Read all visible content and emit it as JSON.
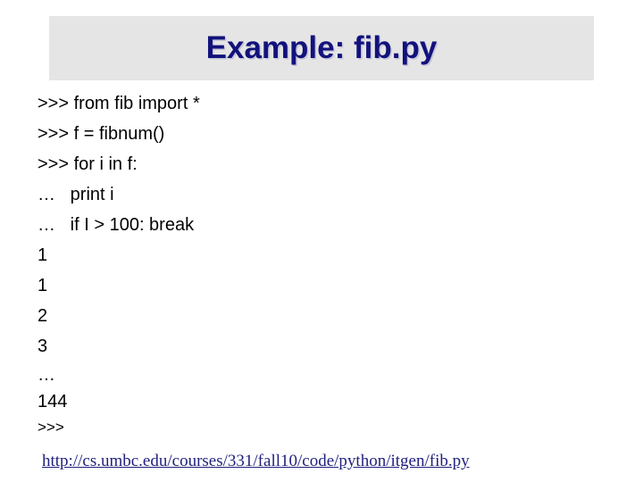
{
  "slide": {
    "title": "Example: fib.py",
    "title_band_color": "#e5e5e5",
    "title_text_color": "#12127c",
    "background_color": "#ffffff"
  },
  "console": {
    "lines": [
      {
        "text": ">>> from fib import *",
        "kind": "input"
      },
      {
        "text": ">>> f = fibnum()",
        "kind": "input"
      },
      {
        "text": ">>> for i in f:",
        "kind": "input"
      },
      {
        "text": "…   print i",
        "kind": "continuation"
      },
      {
        "text": "…   if I > 100: break",
        "kind": "continuation"
      },
      {
        "text": "1",
        "kind": "output"
      },
      {
        "text": "1",
        "kind": "output"
      },
      {
        "text": "2",
        "kind": "output"
      },
      {
        "text": "3",
        "kind": "output"
      },
      {
        "text": "…",
        "kind": "output"
      },
      {
        "text": "144",
        "kind": "output"
      },
      {
        "text": ">>>",
        "kind": "prompt"
      }
    ]
  },
  "source_link": {
    "label": "http://cs.umbc.edu/courses/331/fall10/code/python/itgen/fib.py",
    "color": "#1f1f7e"
  }
}
